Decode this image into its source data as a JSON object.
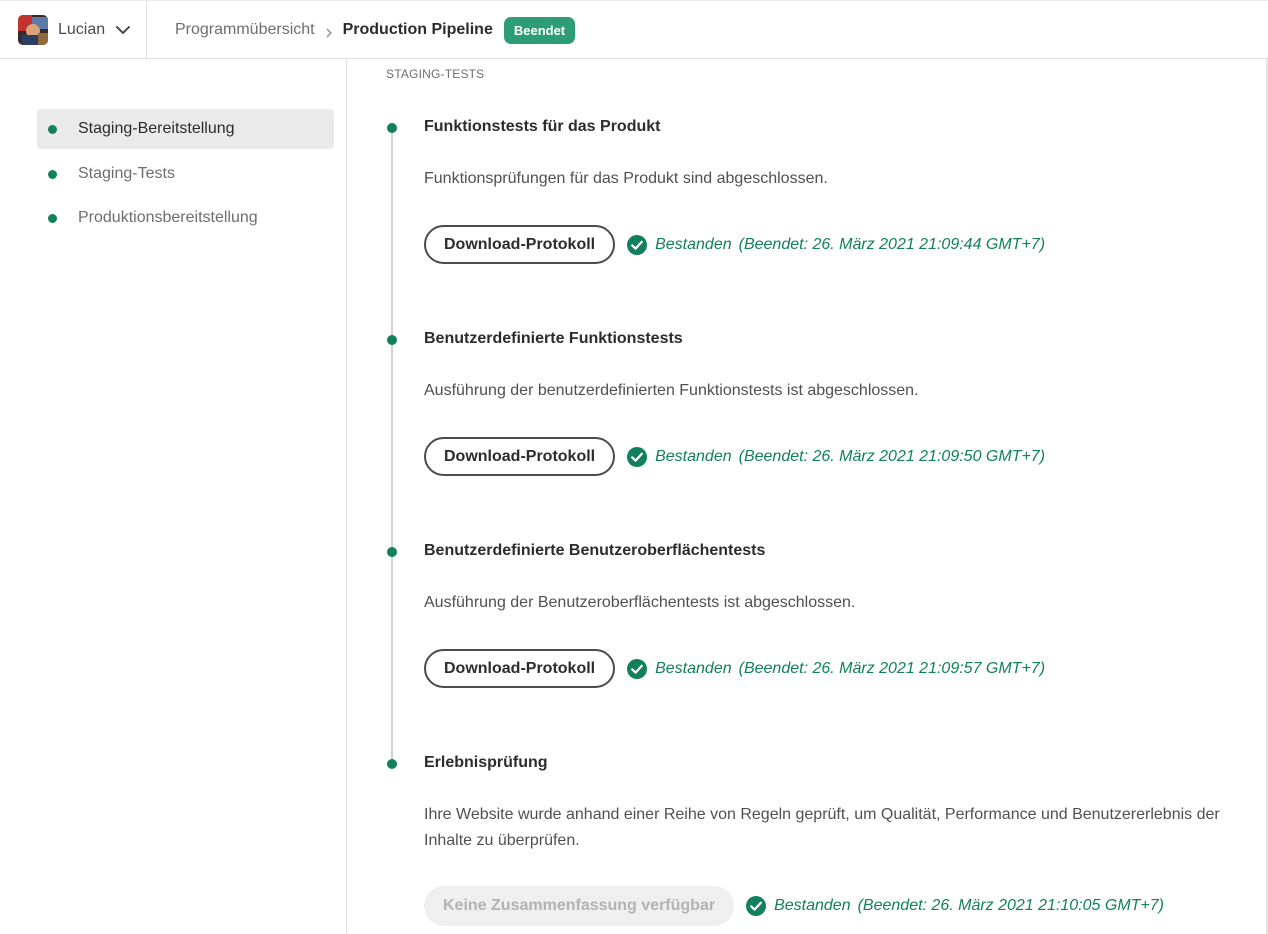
{
  "header": {
    "user_name": "Lucian",
    "breadcrumb_parent": "Programmübersicht",
    "breadcrumb_current": "Production Pipeline",
    "status_badge": "Beendet"
  },
  "sidebar": {
    "items": [
      {
        "label": "Staging-Bereitstellung",
        "active": true
      },
      {
        "label": "Staging-Tests",
        "active": false
      },
      {
        "label": "Produktionsbereitstellung",
        "active": false
      }
    ]
  },
  "main": {
    "section_title": "STAGING-TESTS",
    "steps": [
      {
        "title": "Funktionstests für das Produkt",
        "description": "Funktionsprüfungen für das Produkt sind abgeschlossen.",
        "button_label": "Download-Protokoll",
        "result_status": "Bestanden",
        "result_time": "(Beendet: 26. März 2021 21:09:44 GMT+7)"
      },
      {
        "title": "Benutzerdefinierte Funktionstests",
        "description": "Ausführung der benutzerdefinierten Funktionstests ist abgeschlossen.",
        "button_label": "Download-Protokoll",
        "result_status": "Bestanden",
        "result_time": "(Beendet: 26. März 2021 21:09:50 GMT+7)"
      },
      {
        "title": "Benutzerdefinierte Benutzeroberflächentests",
        "description": "Ausführung der Benutzeroberflächentests ist abgeschlossen.",
        "button_label": "Download-Protokoll",
        "result_status": "Bestanden",
        "result_time": "(Beendet: 26. März 2021 21:09:57 GMT+7)"
      },
      {
        "title": "Erlebnisprüfung",
        "description": "Ihre Website wurde anhand einer Reihe von Regeln geprüft, um Qualität, Performance und Benutzererlebnis der Inhalte zu überprüfen.",
        "button_label": "Keine Zusammenfassung verfügbar",
        "result_status": "Bestanden",
        "result_time": "(Beendet: 26. März 2021 21:10:05 GMT+7)"
      }
    ]
  },
  "colors": {
    "accent_green": "#12805c",
    "badge_green": "#2d9d78"
  },
  "icons": [
    "user-avatar",
    "chevron-down-icon",
    "chevron-right-icon",
    "checkmark-circle-icon"
  ]
}
